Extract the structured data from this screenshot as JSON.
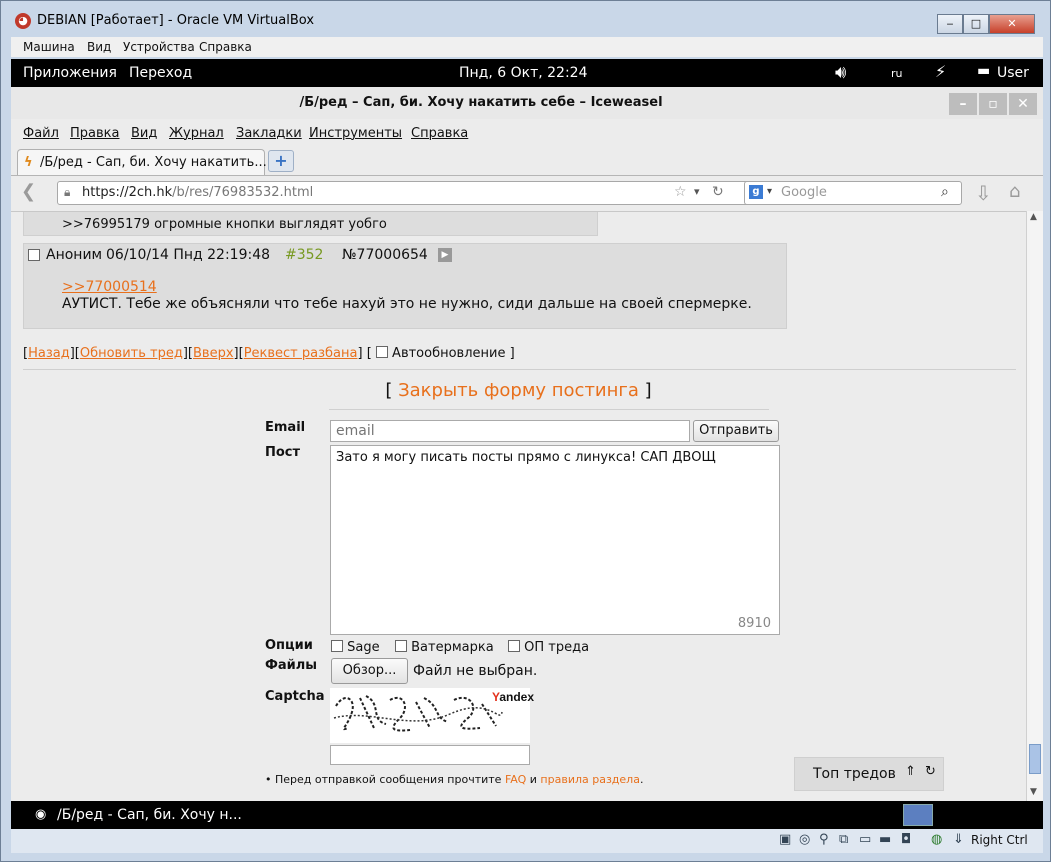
{
  "vbox": {
    "title": "DEBIAN [Работает] - Oracle VM VirtualBox",
    "menu": [
      "Машина",
      "Вид",
      "Устройства",
      "Справка"
    ],
    "host_key": "Right Ctrl"
  },
  "gnome": {
    "apps": "Приложения",
    "places": "Переход",
    "clock": "Пнд,  6 Окт, 22:24",
    "lang": "ru",
    "user": "User"
  },
  "browser": {
    "title": "/Б/ред – Сап, би. Хочу накатить себе – Iceweasel",
    "menu": [
      "Файл",
      "Правка",
      "Вид",
      "Журнал",
      "Закладки",
      "Инструменты",
      "Справка"
    ],
    "tab_label": "/Б/ред - Сап, би. Хочу накатить...",
    "url_host": "https://2ch.hk",
    "url_path": "/b/res/76983532.html",
    "search_engine": "Google",
    "search_placeholder": "Google"
  },
  "thread": {
    "prev_post_fragment": ">>76995179 огромные кнопки выглядят уобго",
    "post": {
      "author": "Аноним",
      "date": "06/10/14 Пнд 22:19:48",
      "num": "#352",
      "id": "№77000654",
      "reply_link": ">>77000514",
      "text": "АУТИСТ. Тебе же объясняли что тебе нахуй это не нужно, сиди дальше на своей спермерке."
    },
    "nav": {
      "back": "Назад",
      "refresh": "Обновить тред",
      "up": "Вверх",
      "request": "Реквест разбана",
      "autoupdate": "Автообновление"
    },
    "close_form": "Закрыть форму постинга"
  },
  "form": {
    "email_label": "Email",
    "email_placeholder": "email",
    "submit": "Отправить",
    "post_label": "Пост",
    "post_text": "Зато я могу писать посты прямо с линукса! САП ДВОЩ",
    "char_counter": "8910",
    "options_label": "Опции",
    "opt_sage": "Sage",
    "opt_watermark": "Ватермарка",
    "opt_op": "ОП треда",
    "files_label": "Файлы",
    "browse": "Обзор...",
    "no_file": "Файл не выбран.",
    "captcha_label": "Captcha",
    "captcha_brand": "Yandex",
    "notice_pre": "• Перед отправкой сообщения прочтите",
    "notice_faq": "FAQ",
    "notice_and": "и",
    "notice_rules": "правила раздела",
    "top_threads": "Топ тредов"
  },
  "taskbar": {
    "window_label": "/Б/ред - Сап, би. Хочу н..."
  },
  "colors": {
    "link_orange": "#e8701c",
    "post_num_green": "#789922",
    "post_bg": "#dddddd",
    "page_bg": "#ececec"
  }
}
